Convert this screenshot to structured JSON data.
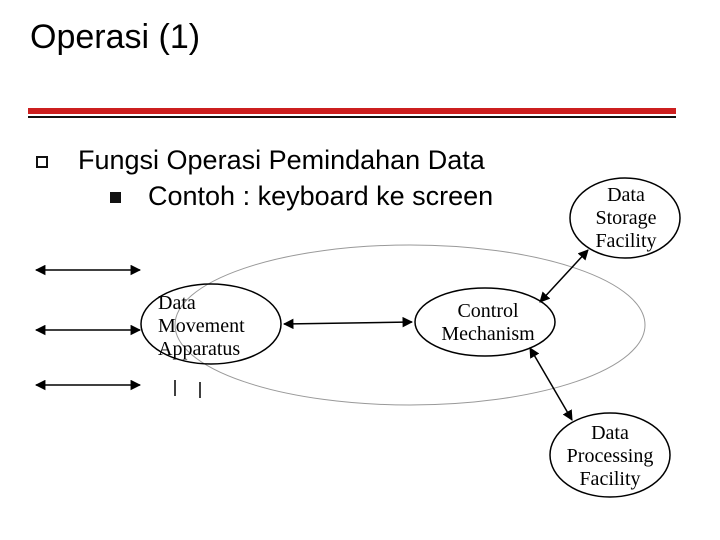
{
  "title": "Operasi (1)",
  "bullets": {
    "level1": "Fungsi Operasi Pemindahan Data",
    "level2": "Contoh : keyboard ke screen"
  },
  "nodes": {
    "storage": "Data\nStorage\nFacility",
    "movement": "Data\nMovement\nApparatus",
    "control": "Control\nMechanism",
    "processing": "Data\nProcessing\nFacility"
  }
}
